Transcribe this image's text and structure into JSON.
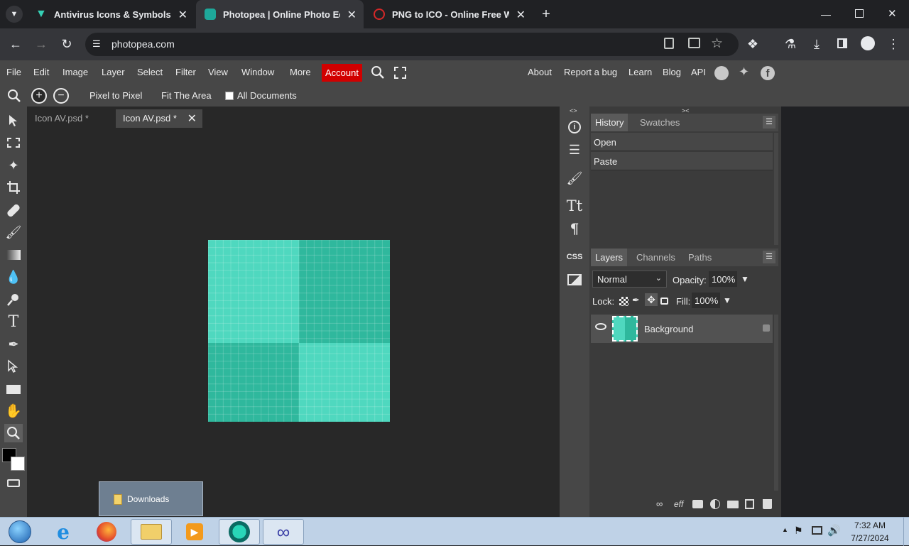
{
  "browser": {
    "tabs": [
      {
        "title": "Antivirus Icons & Symbols",
        "active": false
      },
      {
        "title": "Photopea | Online Photo Editor",
        "active": true
      },
      {
        "title": "PNG to ICO - Online Free Web",
        "active": false
      }
    ],
    "url": "photopea.com"
  },
  "menu": {
    "items": [
      "File",
      "Edit",
      "Image",
      "Layer",
      "Select",
      "Filter",
      "View",
      "Window",
      "More"
    ],
    "account": "Account",
    "right_links": [
      "About",
      "Report a bug",
      "Learn",
      "Blog",
      "API"
    ]
  },
  "options": {
    "pixel_to_pixel": "Pixel to Pixel",
    "fit_the_area": "Fit The Area",
    "all_documents": "All Documents",
    "all_documents_checked": false
  },
  "documents": {
    "tabs": [
      {
        "title": "Icon AV.psd *",
        "active": false
      },
      {
        "title": "Icon AV.psd *",
        "active": true
      }
    ]
  },
  "canvas_colors": {
    "light": "#4fd8bf",
    "dark": "#2fb89d"
  },
  "rightstrip": {
    "css_label": "CSS"
  },
  "history": {
    "tabs": [
      "History",
      "Swatches"
    ],
    "items": [
      "Open",
      "Paste"
    ]
  },
  "layers": {
    "tabs": [
      "Layers",
      "Channels",
      "Paths"
    ],
    "blend_mode": "Normal",
    "opacity_label": "Opacity:",
    "opacity_value": "100%",
    "lock_label": "Lock:",
    "fill_label": "Fill:",
    "fill_value": "100%",
    "items": [
      {
        "name": "Background",
        "visible": true,
        "locked": true
      }
    ]
  },
  "taskbar": {
    "popup_label": "Downloads",
    "time": "7:32 AM",
    "date": "7/27/2024"
  }
}
